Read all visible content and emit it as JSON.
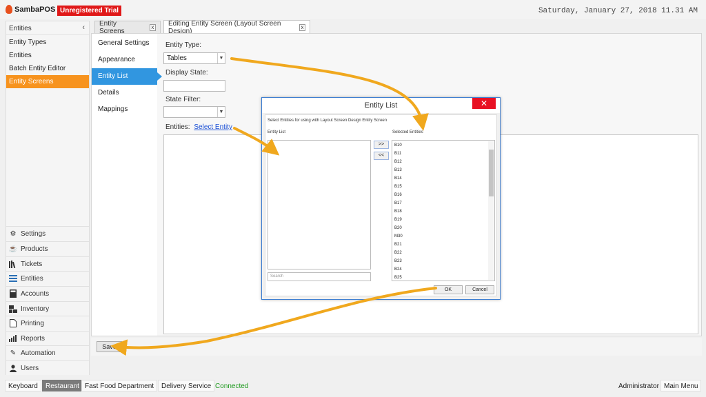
{
  "app": {
    "brand": "SambaPOS",
    "trial_badge": "Unregistered Trial",
    "datetime": "Saturday, January 27, 2018 11.31 AM"
  },
  "sidebar": {
    "header": "Entities",
    "collapse_glyph": "‹",
    "items": [
      {
        "label": "Entity Types"
      },
      {
        "label": "Entities"
      },
      {
        "label": "Batch Entity Editor"
      },
      {
        "label": "Entity Screens",
        "active": true
      }
    ],
    "nav": [
      {
        "label": "Settings",
        "icon": "gear-icon"
      },
      {
        "label": "Products",
        "icon": "coffee-icon"
      },
      {
        "label": "Tickets",
        "icon": "books-icon"
      },
      {
        "label": "Entities",
        "icon": "list-icon"
      },
      {
        "label": "Accounts",
        "icon": "calculator-icon"
      },
      {
        "label": "Inventory",
        "icon": "boxes-icon"
      },
      {
        "label": "Printing",
        "icon": "document-icon"
      },
      {
        "label": "Reports",
        "icon": "bar-chart-icon"
      },
      {
        "label": "Automation",
        "icon": "pencil-icon"
      },
      {
        "label": "Users",
        "icon": "user-icon"
      }
    ]
  },
  "tabs": [
    {
      "label": "Entity Screens",
      "close": "x"
    },
    {
      "label": "Editing Entity Screen (Layout Screen Design)",
      "close": "x",
      "active": true
    }
  ],
  "settings_menu": [
    {
      "label": "General Settings"
    },
    {
      "label": "Appearance"
    },
    {
      "label": "Entity List",
      "active": true
    },
    {
      "label": "Details"
    },
    {
      "label": "Mappings"
    }
  ],
  "form": {
    "entity_type_label": "Entity Type:",
    "entity_type_value": "Tables",
    "display_state_label": "Display State:",
    "display_state_value": "",
    "state_filter_label": "State Filter:",
    "state_filter_value": "",
    "entities_label": "Entities:",
    "select_entity_link": "Select Entity",
    "save_label": "Save"
  },
  "dialog": {
    "title": "Entity List",
    "close_glyph": "✕",
    "instructions": "Select Entities for using with Layout Screen Design Entity Screen",
    "entity_list_label": "Entity List",
    "selected_label": "Selected Entities",
    "add_label": ">>",
    "remove_label": "<<",
    "search_placeholder": "Search",
    "selected_items": [
      "B10",
      "B11",
      "B12",
      "B13",
      "B14",
      "B15",
      "B16",
      "B17",
      "B18",
      "B19",
      "B20",
      "M30",
      "B21",
      "B22",
      "B23",
      "B24",
      "B25"
    ],
    "ok_label": "OK",
    "cancel_label": "Cancel"
  },
  "statusbar": {
    "keyboard": "Keyboard",
    "department": "Restaurant",
    "fast_food": "Fast Food Department",
    "delivery": "Delivery Service",
    "connection": "Connected",
    "user": "Administrator",
    "main_menu": "Main Menu"
  },
  "colors": {
    "accent_orange": "#f7931e",
    "accent_blue": "#3196e0",
    "trial_red": "#e01818",
    "connected_green": "#1e9a1e",
    "annotation_arrow": "#f0a81e"
  }
}
